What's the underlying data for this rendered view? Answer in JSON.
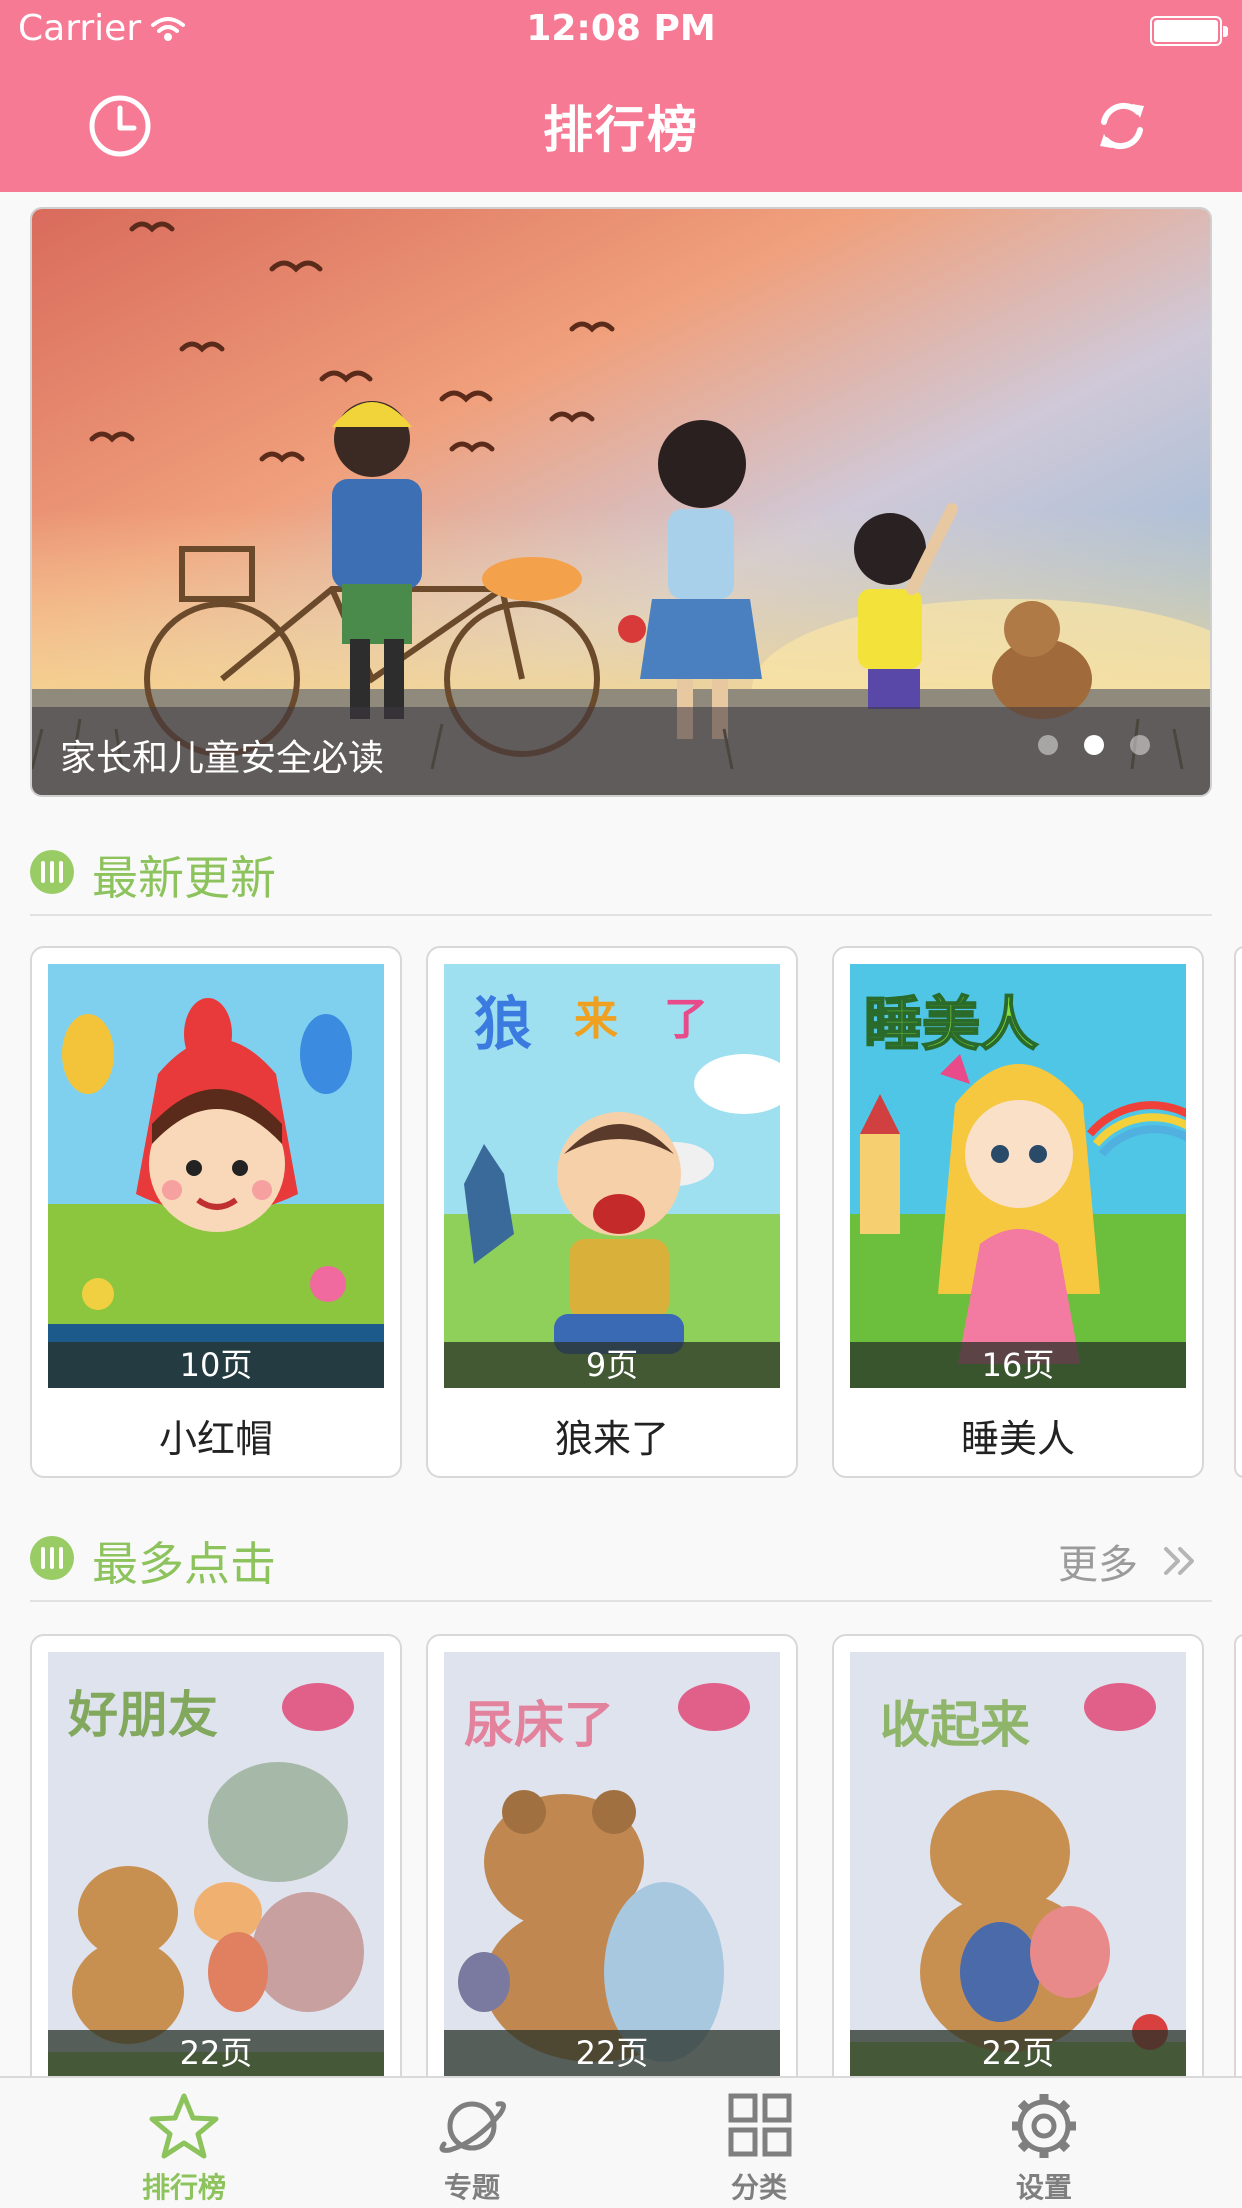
{
  "status_bar": {
    "carrier": "Carrier",
    "time": "12:08 PM"
  },
  "nav": {
    "title": "排行榜",
    "left_icon": "clock-icon",
    "right_icon": "refresh-icon"
  },
  "banner": {
    "caption": "家长和儿童安全必读",
    "page_count": 3,
    "active_index": 1
  },
  "section_latest": {
    "title": "最新更新",
    "books": [
      {
        "pages": "10页",
        "title": "小红帽"
      },
      {
        "pages": "9页",
        "title": "狼来了"
      },
      {
        "pages": "16页",
        "title": "睡美人"
      }
    ]
  },
  "section_popular": {
    "title": "最多点击",
    "more_label": "更多",
    "books": [
      {
        "pages": "22页"
      },
      {
        "pages": "22页"
      },
      {
        "pages": "22页"
      }
    ]
  },
  "tabbar": {
    "items": [
      {
        "label": "排行榜",
        "icon": "star-icon",
        "active": true
      },
      {
        "label": "专题",
        "icon": "planet-icon",
        "active": false
      },
      {
        "label": "分类",
        "icon": "grid-icon",
        "active": false
      },
      {
        "label": "设置",
        "icon": "gear-icon",
        "active": false
      }
    ]
  },
  "colors": {
    "brand_pink": "#f67a94",
    "accent_green": "#8dc35c"
  }
}
